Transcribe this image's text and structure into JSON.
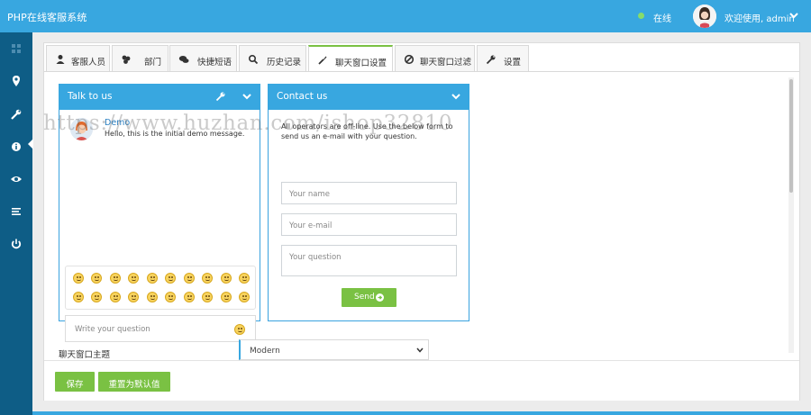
{
  "app": {
    "title": "PHP在线客服系统"
  },
  "header": {
    "status_text": "在线",
    "status_color": "#87dc6a",
    "welcome_text": "欢迎使用, admin"
  },
  "sidebar": {
    "icons": [
      "dashboard-icon",
      "map-marker-icon",
      "wrench-icon",
      "info-icon",
      "eye-icon",
      "list-icon",
      "power-icon"
    ],
    "active_index": 2
  },
  "tabs": [
    {
      "label": "客服人员",
      "icon": "user-icon"
    },
    {
      "label": "部门",
      "icon": "sitemap-icon"
    },
    {
      "label": "快捷短语",
      "icon": "chat-bubbles-icon"
    },
    {
      "label": "历史记录",
      "icon": "search-icon"
    },
    {
      "label": "聊天窗口设置",
      "icon": "brush-icon",
      "active": true
    },
    {
      "label": "聊天窗口过滤",
      "icon": "ban-icon"
    },
    {
      "label": "设置",
      "icon": "wrench-icon"
    }
  ],
  "chat_widget": {
    "title": "Talk to us",
    "message": {
      "name": "Demo",
      "text": "Hello, this is the initial demo message."
    },
    "input_placeholder": "Write your question",
    "emoji_count": 20
  },
  "contact_widget": {
    "title": "Contact us",
    "intro": "All operators are off-line. Use the below form to send us an e-mail with your question.",
    "name_placeholder": "Your name",
    "email_placeholder": "Your e-mail",
    "question_placeholder": "Your question",
    "send_label": "Send"
  },
  "theme": {
    "label": "聊天窗口主题",
    "selected": "Modern"
  },
  "footer": {
    "save_label": "保存",
    "reset_label": "重置为默认值"
  },
  "watermark": "https://www.huzhan.com/ishop32810",
  "colors": {
    "primary": "#38a7e0",
    "sidebar": "#0e5d86",
    "accent_green": "#7ac143"
  }
}
